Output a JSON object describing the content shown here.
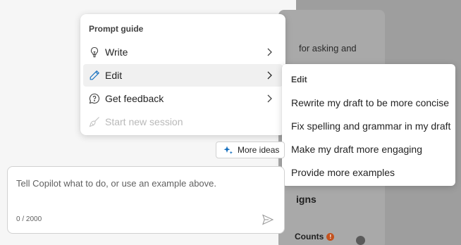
{
  "document": {
    "snippet_text": "for asking and",
    "heading_text": "igns",
    "counts_label": "Counts",
    "warning_icon": "warning-badge-icon",
    "check_icon": "check-circle-icon"
  },
  "prompt_guide": {
    "title": "Prompt guide",
    "items": [
      {
        "label": "Write",
        "icon": "lightbulb-icon",
        "has_submenu": true,
        "disabled": false
      },
      {
        "label": "Edit",
        "icon": "pencil-icon",
        "has_submenu": true,
        "disabled": false
      },
      {
        "label": "Get feedback",
        "icon": "feedback-icon",
        "has_submenu": true,
        "disabled": false
      },
      {
        "label": "Start new session",
        "icon": "broom-icon",
        "has_submenu": false,
        "disabled": true
      }
    ]
  },
  "edit_submenu": {
    "title": "Edit",
    "items": [
      "Rewrite my draft to be more concise",
      "Fix spelling and grammar in my draft",
      "Make my draft more engaging",
      "Provide more examples"
    ]
  },
  "more_ideas": {
    "label": "More ideas",
    "icon": "sparkle-icon",
    "accent": "#0f6cbd"
  },
  "composer": {
    "placeholder": "Tell Copilot what to do, or use an example above.",
    "counter": "0 / 2000",
    "send_icon": "send-icon"
  }
}
